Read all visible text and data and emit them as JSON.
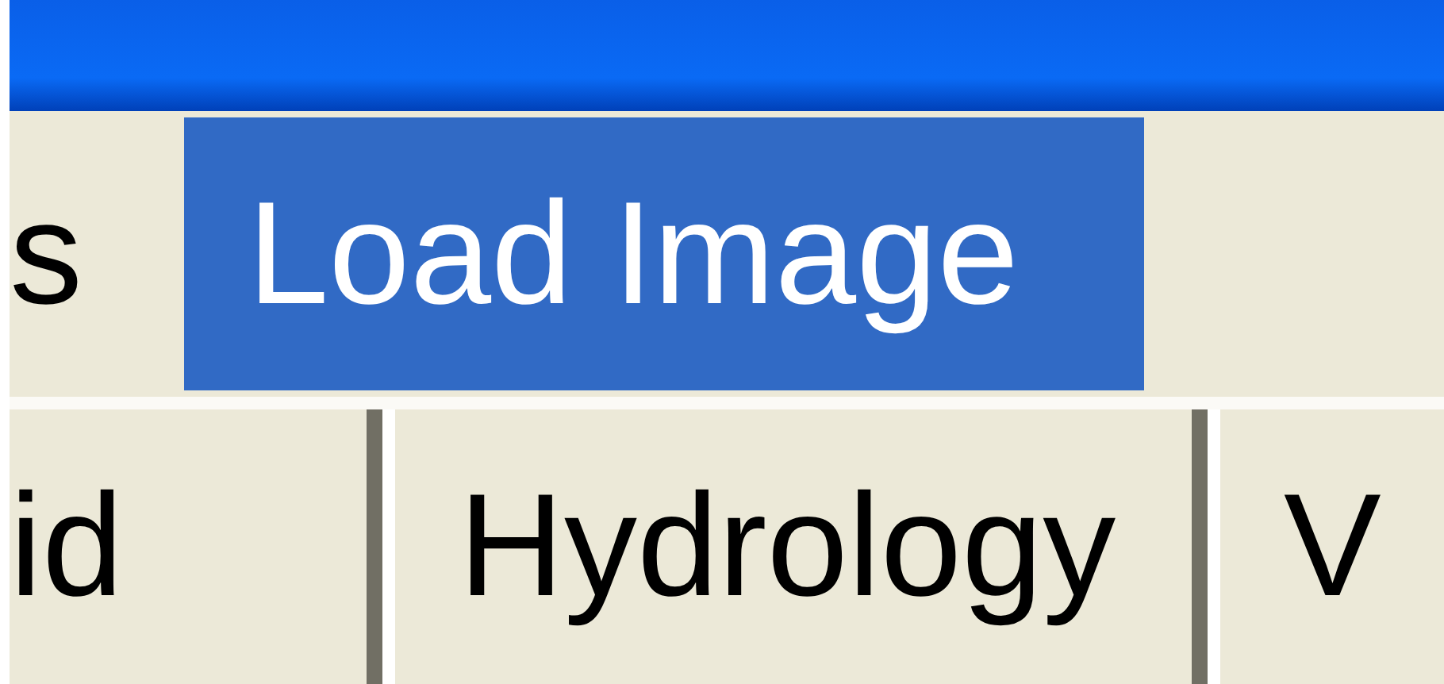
{
  "menu": [
    {
      "label": "s",
      "selected": false
    },
    {
      "label": "Load Image",
      "selected": true
    }
  ],
  "tabs": [
    {
      "label": "id",
      "selected": false
    },
    {
      "label": "Hydrology",
      "selected": false
    },
    {
      "label": "V",
      "selected": false
    }
  ]
}
